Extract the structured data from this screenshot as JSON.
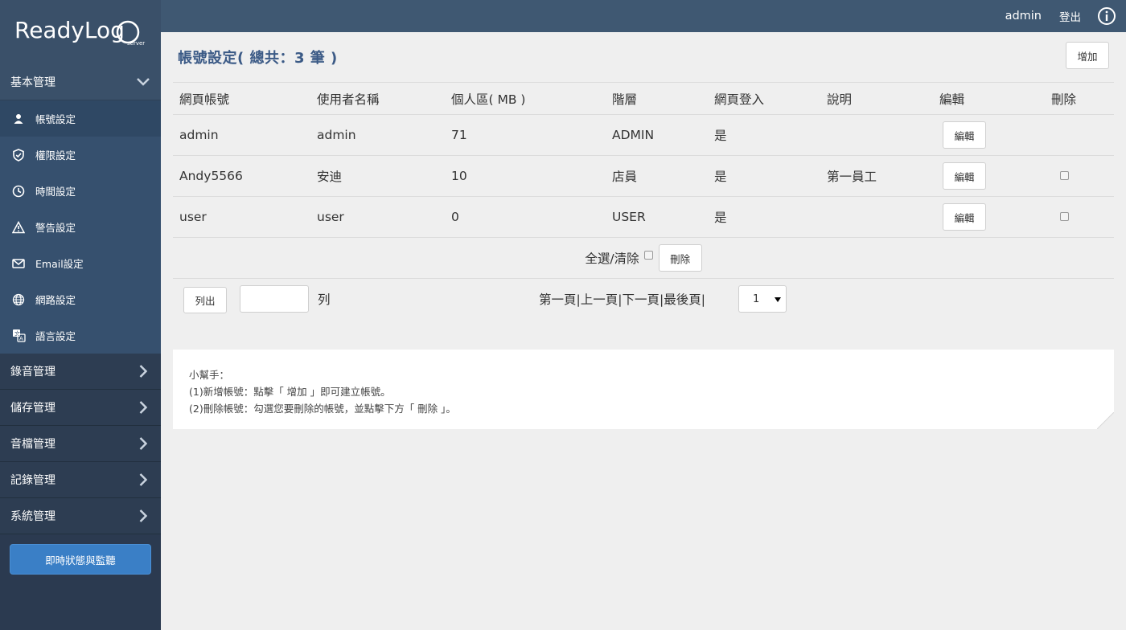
{
  "app": {
    "logo_text": "ReadyLog",
    "logo_sub": "server"
  },
  "topbar": {
    "user": "admin",
    "logout": "登出"
  },
  "sidebar": {
    "groups": [
      {
        "label": "基本管理",
        "open": true
      },
      {
        "label": "錄音管理"
      },
      {
        "label": "儲存管理"
      },
      {
        "label": "音檔管理"
      },
      {
        "label": "記錄管理"
      },
      {
        "label": "系統管理"
      }
    ],
    "items": [
      {
        "label": "帳號設定",
        "icon": "user-icon"
      },
      {
        "label": "權限設定",
        "icon": "shield-icon"
      },
      {
        "label": "時間設定",
        "icon": "clock-icon"
      },
      {
        "label": "警告設定",
        "icon": "warning-icon"
      },
      {
        "label": "Email設定",
        "icon": "mail-icon"
      },
      {
        "label": "網路設定",
        "icon": "globe-icon"
      },
      {
        "label": "語言設定",
        "icon": "language-icon"
      }
    ],
    "live_button": "即時狀態與監聽"
  },
  "main": {
    "title": "帳號設定( 總共：3 筆 )",
    "add_label": "增加",
    "columns": [
      "網頁帳號",
      "使用者名稱",
      "個人區( MB )",
      "階層",
      "網頁登入",
      "說明",
      "編輯",
      "刪除"
    ],
    "edit_label": "編輯",
    "rows": [
      {
        "account": "admin",
        "username": "admin",
        "space": "71",
        "level": "ADMIN",
        "login": "是",
        "note": "",
        "deletable": false
      },
      {
        "account": "Andy5566",
        "username": "安迪",
        "space": "10",
        "level": "店員",
        "login": "是",
        "note": "第一員工",
        "deletable": true
      },
      {
        "account": "user",
        "username": "user",
        "space": "0",
        "level": "USER",
        "login": "是",
        "note": "",
        "deletable": true
      }
    ],
    "select_all_label": "全選/清除",
    "delete_label": "刪除",
    "list_label": "列出",
    "rows_value": "",
    "rows_suffix": "列",
    "pager": {
      "first": "第一頁",
      "prev": "上一頁",
      "next": "下一頁",
      "last": "最後頁",
      "current_page": "1"
    }
  },
  "help": {
    "title": "小幫手：",
    "line1": "(1)新增帳號：點擊「 增加 」即可建立帳號。",
    "line2": "(2)刪除帳號：勾選您要刪除的帳號，並點擊下方「 刪除 」。"
  },
  "colors": {
    "sidebar": "#2b3a50",
    "topbar": "#3f5872",
    "submenu": "#36506e",
    "accent": "#3a7fc6",
    "title": "#3b5a86"
  }
}
